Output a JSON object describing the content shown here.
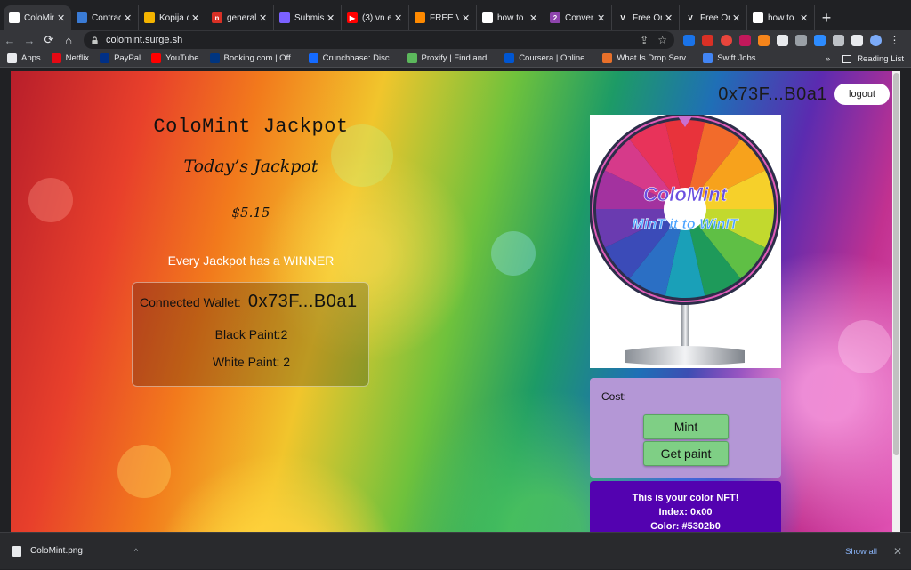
{
  "tabs": [
    {
      "label": "ColoMint",
      "color": "#ffffff",
      "glyph": ""
    },
    {
      "label": "Contract",
      "color": "#3a7bd5",
      "glyph": ""
    },
    {
      "label": "Kopija d",
      "color": "#f4b400",
      "glyph": ""
    },
    {
      "label": "general",
      "color": "#d93025",
      "glyph": "n"
    },
    {
      "label": "Submis",
      "color": "#7b61ff",
      "glyph": ""
    },
    {
      "label": "(3) vn e",
      "color": "#ff0000",
      "glyph": "▶"
    },
    {
      "label": "FREE Vi",
      "color": "#ff8a00",
      "glyph": ""
    },
    {
      "label": "how to",
      "color": "#ffffff",
      "glyph": "G"
    },
    {
      "label": "Conver",
      "color": "#8e44ad",
      "glyph": "2"
    },
    {
      "label": "Free On",
      "color": "#202124",
      "glyph": "V"
    },
    {
      "label": "Free On",
      "color": "#202124",
      "glyph": "V"
    },
    {
      "label": "how to",
      "color": "#ffffff",
      "glyph": "G"
    }
  ],
  "browser": {
    "url": "colomint.surge.sh"
  },
  "bookmarks": [
    {
      "label": "Apps",
      "color": "#e8eaed"
    },
    {
      "label": "Netflix",
      "color": "#e50914"
    },
    {
      "label": "PayPal",
      "color": "#003087"
    },
    {
      "label": "YouTube",
      "color": "#ff0000"
    },
    {
      "label": "Booking.com | Off...",
      "color": "#003580"
    },
    {
      "label": "Crunchbase: Disc...",
      "color": "#146aff"
    },
    {
      "label": "Proxify | Find and...",
      "color": "#5cb85c"
    },
    {
      "label": "Coursera | Online...",
      "color": "#0056d2"
    },
    {
      "label": "What Is Drop Serv...",
      "color": "#e8702a"
    },
    {
      "label": "Swift Jobs",
      "color": "#4285f4"
    }
  ],
  "bookmarks_right": {
    "more": "»",
    "reading_list": "Reading List"
  },
  "page": {
    "top_address": "0x73F...B0a1",
    "logout_label": "logout",
    "title": "ColoMint Jackpot",
    "subtitle": "Today’s Jackpot",
    "jackpot_amount": "$5.15",
    "winner_text": "Every Jackpot has a WINNER",
    "wallet_label": "Connected Wallet:",
    "wallet_address": "0x73F...B0a1",
    "black_paint": "Black Paint:2",
    "white_paint": "White Paint: 2",
    "wheel_title": "ColoMint",
    "wheel_tagline": "MinT it to WinIT",
    "cost_label": "Cost:",
    "mint_label": "Mint",
    "get_paint_label": "Get paint",
    "nft_line1": "This is your color NFT!",
    "nft_line2": "Index: 0x00",
    "nft_line3": "Color: #5302b0",
    "nft_color": "#5302b0"
  },
  "downloads": {
    "file": "ColoMint.png",
    "show_all": "Show all"
  }
}
